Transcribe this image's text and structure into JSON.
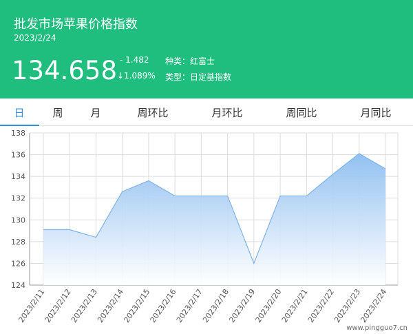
{
  "header": {
    "title": "批发市场苹果价格指数",
    "date": "2023/2/24",
    "price": "134.658",
    "change": "- 1.482",
    "change_pct": "↓1.089%",
    "variety": "种类：红富士",
    "index_type": "类型：日定基指数"
  },
  "tabs": [
    {
      "label": "日",
      "active": true
    },
    {
      "label": "周",
      "active": false
    },
    {
      "label": "月",
      "active": false
    },
    {
      "label": "周环比",
      "active": false
    },
    {
      "label": "月环比",
      "active": false
    },
    {
      "label": "周同比",
      "active": false
    },
    {
      "label": "月同比",
      "active": false
    }
  ],
  "colors": {
    "header_bg": "#1fbd7e",
    "active_tab": "#2d8fdb",
    "line": "#7eb3e8",
    "area_top": "#8dbdf0",
    "area_bottom": "#ffffff"
  },
  "watermark": "www.pingguo7.cn",
  "chart_data": {
    "type": "area",
    "x": [
      "2023/2/11",
      "2023/2/12",
      "2023/2/13",
      "2023/2/14",
      "2023/2/15",
      "2023/2/16",
      "2023/2/17",
      "2023/2/18",
      "2023/2/19",
      "2023/2/20",
      "2023/2/21",
      "2023/2/22",
      "2023/2/23",
      "2023/2/24"
    ],
    "values": [
      129.1,
      129.1,
      128.4,
      132.6,
      133.6,
      132.2,
      132.2,
      132.2,
      126.0,
      132.2,
      132.2,
      134.2,
      136.1,
      134.7
    ],
    "ylim": [
      124,
      138
    ],
    "yticks": [
      124,
      126,
      128,
      130,
      132,
      134,
      136,
      138
    ],
    "grid": true
  }
}
